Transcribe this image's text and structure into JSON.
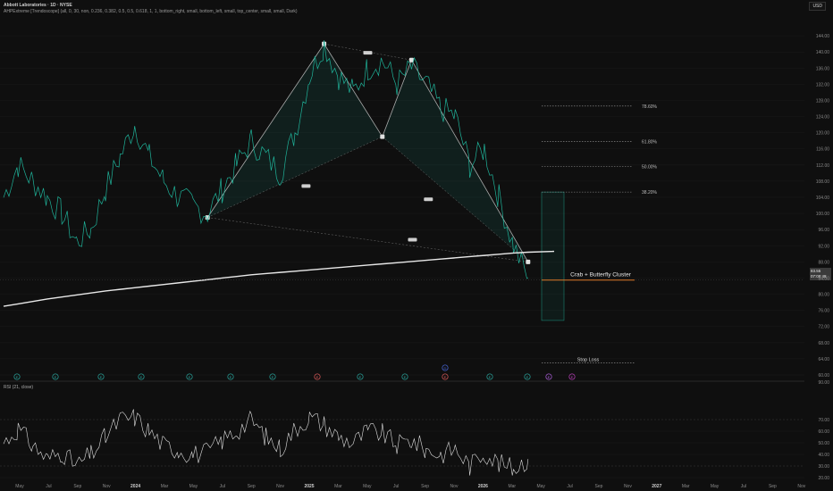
{
  "header": {
    "title": "Abbott Laboratories · 1D · NYSE",
    "indicator": "AHPExtreme [Trendoscope] (all, 0, 30, non, 0.236, 0.382, 0.5, 0.5, 0.618, 1, 1, bottom_right, small, bottom_left, small, top_center, small, small, Dark)",
    "currency": "USD"
  },
  "price_axis": {
    "ticks": [
      "144.00",
      "140.00",
      "136.00",
      "132.00",
      "128.00",
      "124.00",
      "120.00",
      "116.00",
      "112.00",
      "108.00",
      "104.00",
      "100.00",
      "96.00",
      "92.00",
      "88.00",
      "84.00",
      "80.00",
      "76.00",
      "72.00",
      "68.00",
      "64.00",
      "60.00"
    ],
    "current_price": "83.55",
    "current_countdown": "07:09:48"
  },
  "fib_levels": [
    {
      "label": "78.60%",
      "value": 126.6
    },
    {
      "label": "61.80%",
      "value": 117.8
    },
    {
      "label": "50.00%",
      "value": 111.6
    },
    {
      "label": "38.20%",
      "value": 105.3
    }
  ],
  "annotations": {
    "cluster_label": "Crab + Butterfly Cluster",
    "stop_loss_label": "Stop Loss",
    "stop_loss_value": 63.0
  },
  "rsi": {
    "title": "RSI (21, close)",
    "ticks": [
      "70.00",
      "60.00",
      "50.00",
      "40.00",
      "30.00",
      "20.00"
    ],
    "ticks_top": [
      "90.00"
    ]
  },
  "time_axis": {
    "labels": [
      "May",
      "Jul",
      "Sep",
      "Nov",
      "2024",
      "Mar",
      "May",
      "Jul",
      "Sep",
      "Nov",
      "2025",
      "Mar",
      "May",
      "Jul",
      "Sep",
      "Nov",
      "2026",
      "Mar",
      "May",
      "Jul",
      "Sep",
      "Nov",
      "2027",
      "Mar",
      "May",
      "Jul",
      "Sep",
      "Nov"
    ]
  },
  "event_markers": [
    "E",
    "E",
    "E",
    "E",
    "E",
    "E",
    "E",
    "E",
    "E",
    "E",
    "E",
    "E",
    "E",
    "E",
    "E",
    "E",
    "E",
    "D"
  ],
  "chart_data": {
    "type": "line",
    "title": "Abbott Laboratories · 1D · NYSE",
    "xlabel": "",
    "ylabel": "",
    "ylim": [
      60,
      148
    ],
    "x": [
      "2023-05",
      "2023-06",
      "2023-07",
      "2023-08",
      "2023-09",
      "2023-10",
      "2023-11",
      "2023-12",
      "2024-01",
      "2024-02",
      "2024-03",
      "2024-04",
      "2024-05",
      "2024-06",
      "2024-07",
      "2024-08",
      "2024-09",
      "2024-10",
      "2024-11",
      "2024-12",
      "2025-01",
      "2025-02",
      "2025-03",
      "2025-04",
      "2025-05",
      "2025-06",
      "2025-07",
      "2025-08",
      "2025-09",
      "2025-10",
      "2025-11",
      "2025-12",
      "2026-01",
      "2026-02",
      "2026-03",
      "2026-04",
      "2026-05"
    ],
    "series": [
      {
        "values": [
          104,
          112,
          108,
          104,
          100,
          93,
          96,
          106,
          114,
          122,
          114,
          108,
          104,
          102,
          100,
          106,
          112,
          118,
          114,
          110,
          120,
          134,
          142,
          134,
          130,
          136,
          138,
          132,
          136,
          132,
          126,
          124,
          112,
          116,
          104,
          92,
          84
        ]
      },
      {
        "values": [
          77,
          77.6,
          78.2,
          78.8,
          79.3,
          79.8,
          80.3,
          80.8,
          81.2,
          81.6,
          82.0,
          82.4,
          82.8,
          83.2,
          83.6,
          84.0,
          84.4,
          84.8,
          85.1,
          85.4,
          85.7,
          86.0,
          86.3,
          86.6,
          86.9,
          87.2,
          87.5,
          87.8,
          88.1,
          88.4,
          88.7,
          89.0,
          89.3,
          89.6,
          89.9,
          90.2,
          90.4
        ]
      }
    ],
    "harmonic_points": [
      {
        "label": "X",
        "x": "2024-07",
        "y": 99
      },
      {
        "label": "A",
        "x": "2025-03",
        "y": 142
      },
      {
        "label": "B",
        "x": "2025-07",
        "y": 119
      },
      {
        "label": "C",
        "x": "2025-09",
        "y": 138
      },
      {
        "label": "D",
        "x": "2026-05",
        "y": 88
      }
    ],
    "rsi_series": {
      "values": [
        50,
        62,
        48,
        36,
        42,
        30,
        40,
        55,
        70,
        72,
        60,
        48,
        44,
        40,
        42,
        52,
        60,
        70,
        55,
        45,
        62,
        72,
        66,
        55,
        50,
        60,
        58,
        48,
        52,
        44,
        40,
        45,
        30,
        42,
        32,
        28,
        36
      ]
    },
    "rsi_ylim": [
      20,
      90
    ]
  },
  "colors": {
    "background": "#0f0f0f",
    "price_line": "#1fb39a",
    "ma_line": "#e8e8e8",
    "pattern": "#cfcfcf",
    "cluster_box": "#1fb39a",
    "cluster_line": "#e07b2a",
    "grid": "#1c1c1c"
  }
}
